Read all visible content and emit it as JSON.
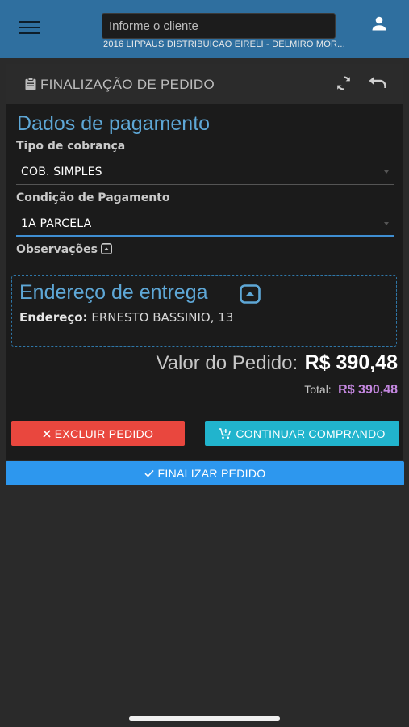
{
  "header": {
    "client_placeholder": "Informe o cliente",
    "client_name": "2016 LIPPAUS DISTRIBUICAO EIRELI - DELMIRO MOR..."
  },
  "card": {
    "title": "FINALIZAÇÃO DE PEDIDO",
    "payment_title": "Dados de pagamento",
    "billing_type_label": "Tipo de cobrança",
    "billing_type_value": "COB. SIMPLES",
    "payment_condition_label": "Condição de Pagamento",
    "payment_condition_value": "1A PARCELA",
    "observations_label": "Observações",
    "address": {
      "title": "Endereço de entrega",
      "label": "Endereço:",
      "value": "ERNESTO BASSINIO, 13"
    },
    "order_value_label": "Valor do Pedido:",
    "order_value": "R$ 390,48",
    "total_label": "Total:",
    "total_value": "R$ 390,48"
  },
  "actions": {
    "delete_label": "EXCLUIR PEDIDO",
    "continue_label": "CONTINUAR COMPRANDO",
    "finish_label": "FINALIZAR PEDIDO"
  },
  "colors": {
    "header_bg": "#2f6f9f",
    "accent_blue": "#5ea7d6",
    "delete": "#e9473e",
    "continue": "#21b4cd",
    "finish": "#2d97ee",
    "total_purple": "#c487e0"
  },
  "icons": [
    "menu-icon",
    "user-icon",
    "clipboard-icon",
    "refresh-icon",
    "undo-icon",
    "chevron-up-box-icon",
    "close-icon",
    "cart-plus-icon",
    "check-icon"
  ]
}
